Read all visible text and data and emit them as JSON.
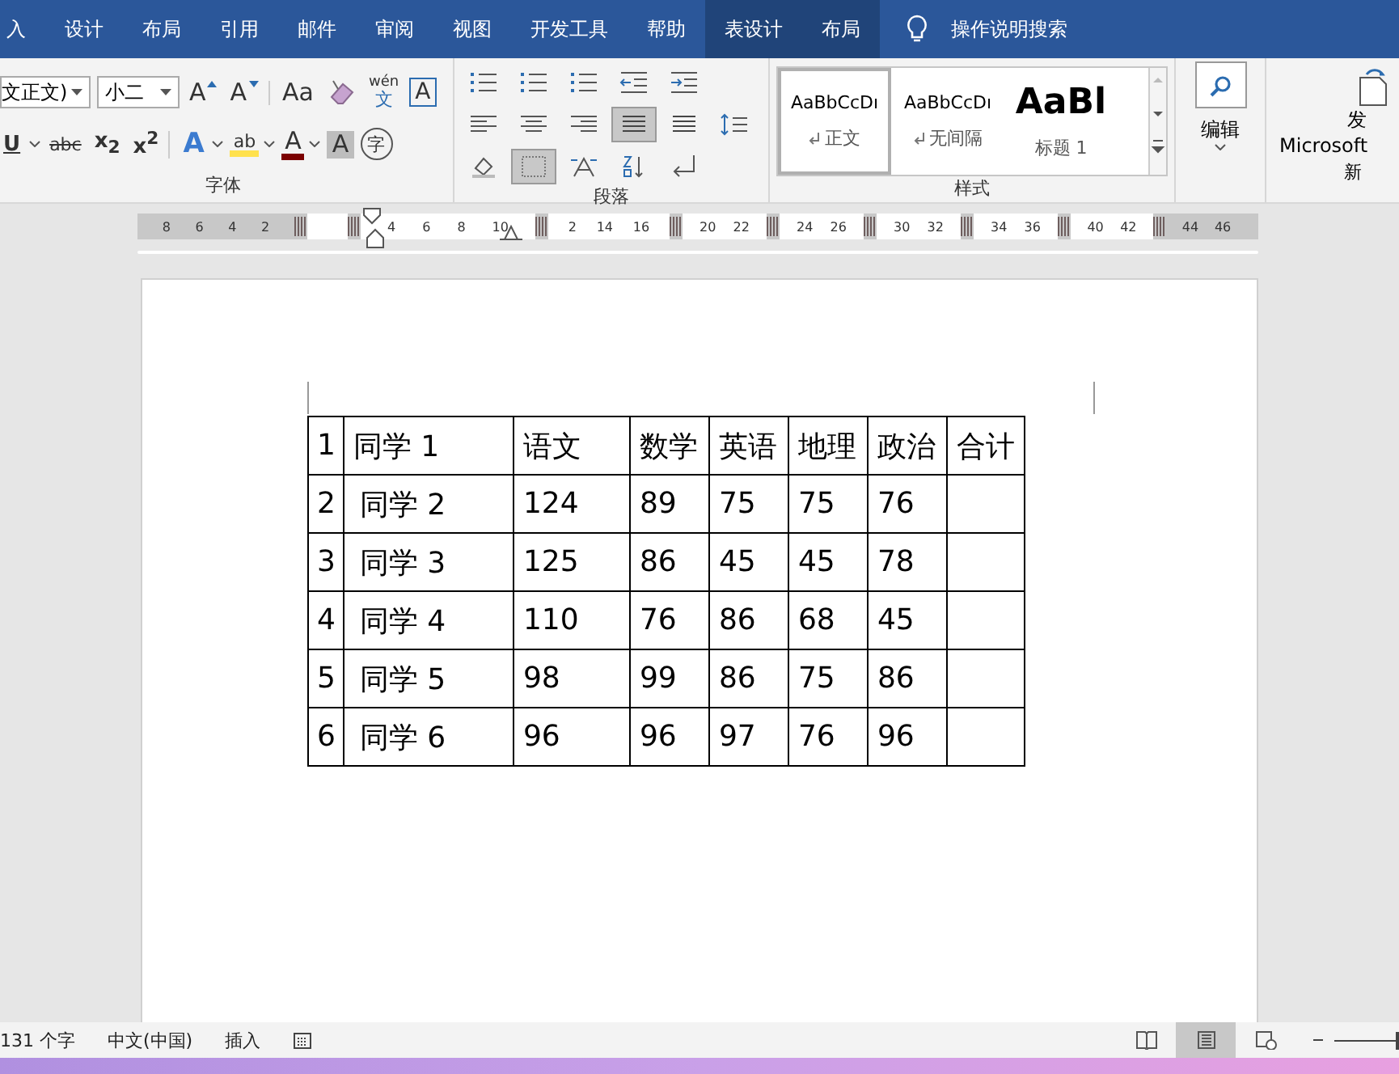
{
  "ribbon_tabs": [
    {
      "label": "入",
      "contextual": false
    },
    {
      "label": "设计",
      "contextual": false
    },
    {
      "label": "布局",
      "contextual": false
    },
    {
      "label": "引用",
      "contextual": false
    },
    {
      "label": "邮件",
      "contextual": false
    },
    {
      "label": "审阅",
      "contextual": false
    },
    {
      "label": "视图",
      "contextual": false
    },
    {
      "label": "开发工具",
      "contextual": false
    },
    {
      "label": "帮助",
      "contextual": false
    },
    {
      "label": "表设计",
      "contextual": true
    },
    {
      "label": "布局",
      "contextual": true
    }
  ],
  "tell_me": {
    "label": "操作说明搜索"
  },
  "font_group": {
    "font_name": "文正文)",
    "font_size": "小二",
    "label": "字体",
    "row1": [
      {
        "kind": "grow",
        "label": "A"
      },
      {
        "kind": "shrink",
        "label": "A"
      },
      {
        "kind": "case",
        "label": "Aa"
      },
      {
        "kind": "clear"
      },
      {
        "kind": "phonetic",
        "label": "wén",
        "sub": "文"
      },
      {
        "kind": "border",
        "label": "A"
      }
    ],
    "row2": [
      {
        "kind": "underline",
        "label": "U"
      },
      {
        "kind": "strike",
        "label": "abc"
      },
      {
        "kind": "script",
        "label": "x$_{2}$"
      },
      {
        "kind": "script",
        "label": "x$^{2}$"
      },
      {
        "kind": "effects",
        "label": "A"
      },
      {
        "kind": "highlight",
        "label": "ab"
      },
      {
        "kind": "color",
        "label": "A"
      },
      {
        "kind": "shading",
        "label": "A"
      },
      {
        "kind": "enclose",
        "label": "字"
      }
    ]
  },
  "paragraph_group": {
    "label": "段落",
    "row1": [
      {
        "kind": "bullets",
        "selected": false
      },
      {
        "kind": "numbering",
        "selected": false
      },
      {
        "kind": "multilevel",
        "selected": false
      },
      {
        "kind": "outdent",
        "selected": false
      },
      {
        "kind": "indent",
        "selected": false
      }
    ],
    "row2": [
      {
        "kind": "align-left",
        "selected": false
      },
      {
        "kind": "align-center",
        "selected": false
      },
      {
        "kind": "align-right",
        "selected": false
      },
      {
        "kind": "justify",
        "selected": true
      },
      {
        "kind": "distribute",
        "selected": false
      },
      {
        "kind": "spacing",
        "selected": false
      }
    ],
    "row3": [
      {
        "kind": "shading",
        "selected": false
      },
      {
        "kind": "borders",
        "selected": true
      },
      {
        "kind": "asian-layout",
        "selected": false
      },
      {
        "kind": "sort",
        "selected": false
      },
      {
        "kind": "marks",
        "selected": false
      }
    ]
  },
  "styles_group": {
    "label": "样式",
    "items": [
      {
        "kind": "normal",
        "sample": "AaBbCcDı",
        "name": "正文",
        "selected": true
      },
      {
        "kind": "normal",
        "sample": "AaBbCcDı",
        "name": "无间隔",
        "selected": false
      },
      {
        "kind": "heading",
        "sample": "AaBl",
        "name": "标题 1",
        "selected": false
      }
    ]
  },
  "editing": {
    "label": "编辑"
  },
  "send_group": {
    "label_line1": "发",
    "label_line2": "Microsoft",
    "group_label": "新"
  },
  "ruler": [
    {
      "kind": "margin",
      "numbers": [
        "8",
        "6",
        "4",
        "2"
      ]
    },
    {
      "kind": "cell"
    },
    {
      "kind": "cell",
      "numbers": [
        "4",
        "6",
        "8",
        "10"
      ]
    },
    {
      "kind": "cell",
      "numbers": [
        "2",
        "14",
        "16"
      ]
    },
    {
      "kind": "cell",
      "numbers": [
        "20",
        "22"
      ]
    },
    {
      "kind": "cell",
      "numbers": [
        "24",
        "26"
      ]
    },
    {
      "kind": "cell",
      "numbers": [
        "30",
        "32"
      ]
    },
    {
      "kind": "cell",
      "numbers": [
        "34",
        "36"
      ]
    },
    {
      "kind": "cell",
      "numbers": [
        "40",
        "42"
      ]
    },
    {
      "kind": "margin",
      "numbers": [
        "44",
        "46"
      ]
    }
  ],
  "table": {
    "header": [
      "1",
      "同学 1",
      "语文",
      "数学",
      "英语",
      "地理",
      "政治",
      "合计"
    ],
    "rows": [
      [
        "2",
        "同学 2",
        "124",
        "89",
        "75",
        "75",
        "76"
      ],
      [
        "3",
        "同学 3",
        "125",
        "86",
        "45",
        "45",
        "78"
      ],
      [
        "4",
        "同学 4",
        "110",
        "76",
        "86",
        "68",
        "45"
      ],
      [
        "5",
        "同学 5",
        "98",
        "99",
        "86",
        "75",
        "86"
      ],
      [
        "6",
        "同学 6",
        "96",
        "96",
        "97",
        "76",
        "96"
      ]
    ]
  },
  "status_bar": {
    "items": [
      "131 个字",
      "中文(中国)",
      "插入"
    ],
    "zoom": {
      "level": 1
    },
    "views": [
      {
        "kind": "read",
        "selected": false
      },
      {
        "kind": "print",
        "selected": true
      },
      {
        "kind": "web",
        "selected": false
      }
    ]
  }
}
